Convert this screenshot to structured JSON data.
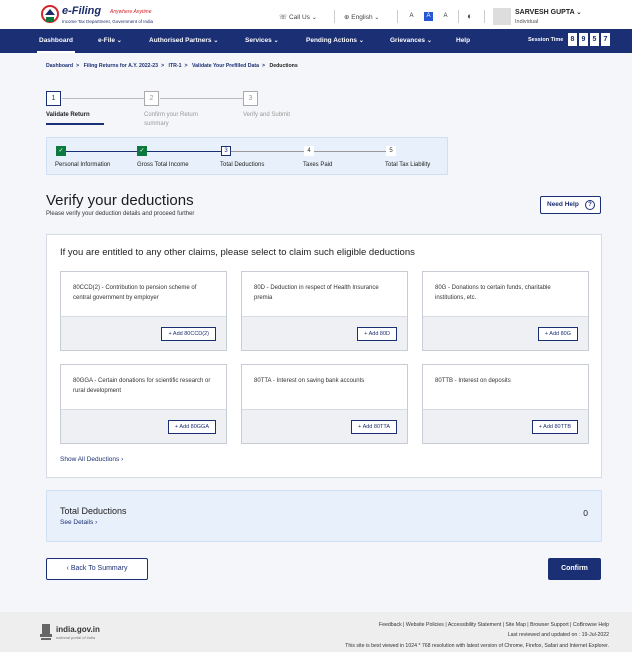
{
  "header": {
    "brand": "e-Filing",
    "tagline": "Anywhere Anytime",
    "sub": "Income Tax Department, Government of India",
    "call_us": "Call Us",
    "language": "English",
    "font_small": "A",
    "font_normal": "A",
    "font_large": "A",
    "user_name": "SARVESH GUPTA",
    "user_role": "Individual"
  },
  "nav": {
    "items": [
      "Dashboard",
      "e-File",
      "Authorised Partners",
      "Services",
      "Pending Actions",
      "Grievances",
      "Help"
    ],
    "session_label": "Session Time",
    "timer": [
      "8",
      "9",
      "5",
      "7"
    ]
  },
  "breadcrumb": [
    "Dashboard",
    "Filing Returns for A.Y. 2022-23",
    "ITR-1",
    "Validate Your Prefilled Data",
    "Deductions"
  ],
  "top_steps": [
    {
      "num": "1",
      "label": "Validate Return"
    },
    {
      "num": "2",
      "label": "Confirm your Return summary"
    },
    {
      "num": "3",
      "label": "Verify and Submit"
    }
  ],
  "inner_steps": [
    {
      "num": "✓",
      "label": "Personal Information"
    },
    {
      "num": "✓",
      "label": "Gross Total Income"
    },
    {
      "num": "3",
      "label": "Total Deductions"
    },
    {
      "num": "4",
      "label": "Taxes Paid"
    },
    {
      "num": "5",
      "label": "Total Tax Liability"
    }
  ],
  "page": {
    "title": "Verify your deductions",
    "subtitle": "Please verify your deduction details and proceed further",
    "need_help": "Need Help",
    "help_icon": "?"
  },
  "panel": {
    "title": "If you are entitled to any other claims, please select to claim such eligible deductions",
    "cards": [
      {
        "text": "80CCD(2) - Contribution to pension scheme of central government by employer",
        "button": "+ Add 80CCD(2)"
      },
      {
        "text": "80D - Deduction in respect of Health Insurance premia",
        "button": "+ Add 80D"
      },
      {
        "text": "80G - Donations to certain funds, charitable institutions, etc.",
        "button": "+ Add 80G"
      },
      {
        "text": "80GGA - Certain donations for scientific research or rural development",
        "button": "+ Add 80GGA"
      },
      {
        "text": "80TTA - Interest on saving bank accounts",
        "button": "+ Add 80TTA"
      },
      {
        "text": "80TTB - Interest on deposits",
        "button": "+ Add 80TTB"
      }
    ],
    "show_all": "Show All Deductions"
  },
  "total": {
    "title": "Total Deductions",
    "see_details": "See Details",
    "value": "0"
  },
  "actions": {
    "back": "Back To Summary",
    "confirm": "Confirm"
  },
  "footer": {
    "logo_title": "india.gov.in",
    "logo_sub": "national portal of india",
    "links": "Feedback | Website Policies | Accessibility Statement | Site Map | Browser Support | CoBrowse Help",
    "updated": "Last reviewed and updated on : 19-Jul-2022",
    "note": "This site is best viewed in 1024 * 768 resolution with latest version of Chrome, Firefox, Safari and Internet Explorer."
  },
  "colors": {
    "primary": "#1b2f74",
    "success": "#0d7a3d",
    "light_panel": "#e7f0fb"
  }
}
